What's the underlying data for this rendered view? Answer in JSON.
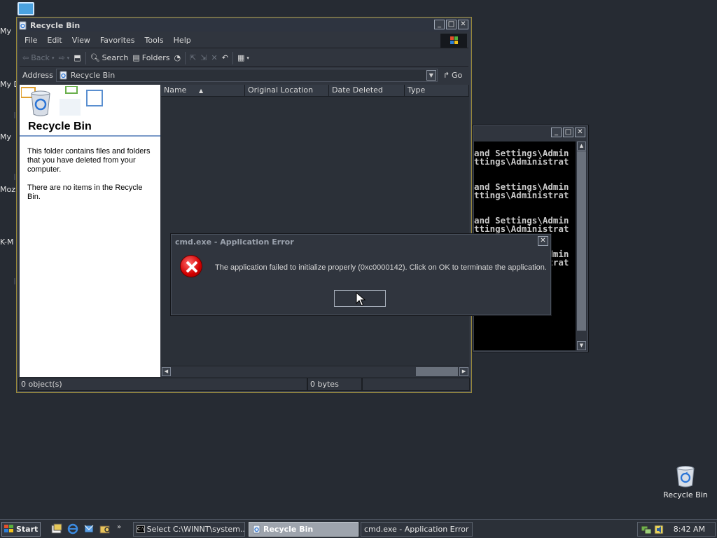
{
  "desktop": {
    "left_labels": [
      "My",
      "My D",
      "My",
      "Moz",
      "K-M"
    ],
    "recycle_bin_label": "Recycle Bin"
  },
  "recycle_window": {
    "title": "Recycle Bin",
    "menu": [
      "File",
      "Edit",
      "View",
      "Favorites",
      "Tools",
      "Help"
    ],
    "toolbar": {
      "back": "Back",
      "search": "Search",
      "folders": "Folders"
    },
    "address_label": "Address",
    "address_value": "Recycle Bin",
    "go_label": "Go",
    "left_pane": {
      "title": "Recycle Bin",
      "description": "This folder contains files and folders that you have deleted from your computer.",
      "empty_note": "There are no items in the Recycle Bin."
    },
    "columns": [
      "Name",
      "Original Location",
      "Date Deleted",
      "Type"
    ],
    "status": {
      "objects": "0 object(s)",
      "size": "0 bytes"
    }
  },
  "cmd_window": {
    "lines": [
      "and Settings\\Admin",
      "ttings\\Administrat",
      "",
      "and Settings\\Admin",
      "ttings\\Administrat",
      "",
      "and Settings\\Admin",
      "ttings\\Administrat",
      "",
      "and Settings\\Admin",
      "ttings\\Administrat"
    ]
  },
  "error_dialog": {
    "title": "cmd.exe - Application Error",
    "message": "The application failed to initialize properly (0xc0000142). Click on OK to terminate the application.",
    "ok_label": ""
  },
  "taskbar": {
    "start_label": "Start",
    "tasks": [
      "Select C:\\WINNT\\system...",
      "Recycle Bin",
      "cmd.exe - Application Error"
    ],
    "clock": "8:42 AM"
  },
  "colors": {
    "desktop": "#262b33",
    "window": "#30353e",
    "active_task": "#9ea4ad",
    "error_red": "#d10000"
  }
}
